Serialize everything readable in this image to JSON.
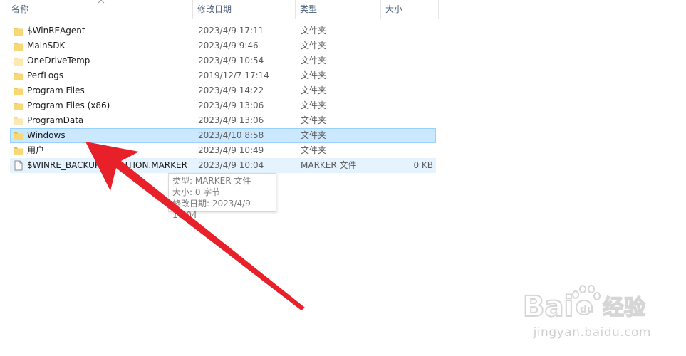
{
  "columns": {
    "name": "名称",
    "date": "修改日期",
    "type": "类型",
    "size": "大小"
  },
  "files": [
    {
      "name": "$WinREAgent",
      "date": "2023/4/9 17:11",
      "type": "文件夹",
      "size": "",
      "icon": "folder-icon",
      "state": "normal"
    },
    {
      "name": "MainSDK",
      "date": "2023/4/9 9:46",
      "type": "文件夹",
      "size": "",
      "icon": "folder-icon",
      "state": "normal"
    },
    {
      "name": "OneDriveTemp",
      "date": "2023/4/9 10:54",
      "type": "文件夹",
      "size": "",
      "icon": "folder-icon",
      "state": "normal"
    },
    {
      "name": "PerfLogs",
      "date": "2019/12/7 17:14",
      "type": "文件夹",
      "size": "",
      "icon": "folder-icon",
      "state": "normal"
    },
    {
      "name": "Program Files",
      "date": "2023/4/9 14:22",
      "type": "文件夹",
      "size": "",
      "icon": "folder-icon",
      "state": "normal"
    },
    {
      "name": "Program Files (x86)",
      "date": "2023/4/9 13:06",
      "type": "文件夹",
      "size": "",
      "icon": "folder-icon",
      "state": "normal"
    },
    {
      "name": "ProgramData",
      "date": "2023/4/9 13:06",
      "type": "文件夹",
      "size": "",
      "icon": "folder-icon",
      "state": "normal"
    },
    {
      "name": "Windows",
      "date": "2023/4/10 8:58",
      "type": "文件夹",
      "size": "",
      "icon": "folder-icon",
      "state": "selected"
    },
    {
      "name": "用户",
      "date": "2023/4/9 10:49",
      "type": "文件夹",
      "size": "",
      "icon": "folder-icon",
      "state": "normal"
    },
    {
      "name": "$WINRE_BACKUP_PARTITION.MARKER",
      "date": "2023/4/9 10:04",
      "type": "MARKER 文件",
      "size": "0 KB",
      "icon": "file-icon",
      "state": "hover"
    }
  ],
  "tooltip": {
    "type_line": "类型: MARKER 文件",
    "size_line": "大小: 0 字节",
    "date_line": "修改日期: 2023/4/9 10:04"
  },
  "watermark": {
    "brand": "Baidu 经验",
    "url": "jingyan.baidu.com"
  },
  "colors": {
    "selected_bg": "#cce8ff",
    "selected_border": "#99d1ff",
    "hover_bg": "#e5f3ff",
    "folder": "#f8d775",
    "arrow": "#e8202a"
  }
}
